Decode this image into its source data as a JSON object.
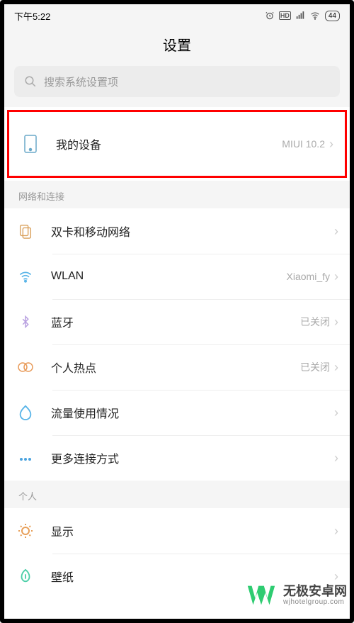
{
  "status": {
    "time": "下午5:22",
    "battery": "44"
  },
  "page_title": "设置",
  "search": {
    "placeholder": "搜索系统设置项"
  },
  "my_device": {
    "label": "我的设备",
    "value": "MIUI 10.2"
  },
  "sections": {
    "network": {
      "header": "网络和连接",
      "items": [
        {
          "icon": "sim-icon",
          "label": "双卡和移动网络",
          "value": ""
        },
        {
          "icon": "wifi-icon",
          "label": "WLAN",
          "value": "Xiaomi_fy"
        },
        {
          "icon": "bluetooth-icon",
          "label": "蓝牙",
          "value": "已关闭"
        },
        {
          "icon": "hotspot-icon",
          "label": "个人热点",
          "value": "已关闭"
        },
        {
          "icon": "data-usage-icon",
          "label": "流量使用情况",
          "value": ""
        },
        {
          "icon": "more-icon",
          "label": "更多连接方式",
          "value": ""
        }
      ]
    },
    "personal": {
      "header": "个人",
      "items": [
        {
          "icon": "display-icon",
          "label": "显示",
          "value": ""
        },
        {
          "icon": "wallpaper-icon",
          "label": "壁纸",
          "value": ""
        }
      ]
    }
  },
  "watermark": {
    "title": "无极安卓网",
    "url": "wjhotelgroup.com"
  }
}
